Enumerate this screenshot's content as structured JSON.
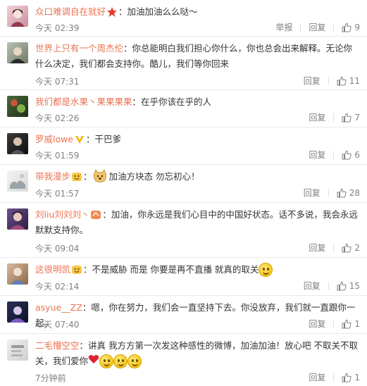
{
  "comments": [
    {
      "username": "众口难调自在就好",
      "badge": "star-badge-icon",
      "text": "：加油加油么么哒～",
      "time": "今天 02:39",
      "report_label": "举报",
      "reply_label": "回复",
      "likes": "9"
    },
    {
      "username": "世界上只有一个周杰伦",
      "text": "：你总能明白我们担心你什么，你也总会出来解释。无论你什么决定，我们都会支持你。酷儿，我们等你回来",
      "time": "今天 07:31",
      "reply_label": "回复",
      "likes": "11"
    },
    {
      "username": "我们都是水果丶果果果果",
      "text": "：在乎你该在乎的人",
      "time": "今天 02:26",
      "reply_label": "回复",
      "likes": "7"
    },
    {
      "username": "罗威lowe",
      "badge": "vip-v-badge-icon",
      "text": "：干巴爹",
      "time": "今天 01:59",
      "reply_label": "回复",
      "likes": "6"
    },
    {
      "username": "带我漫步",
      "badge": "fan-badge-icon",
      "text_prefix": "：",
      "text": "加油方块态 勿忘初心！",
      "time": "今天 01:57",
      "reply_label": "回复",
      "likes": "28"
    },
    {
      "username": "刘liu刘刘刘丶",
      "badge": "fan-badge-icon",
      "text": "：加油，你永远是我们心目中的中国好状态。话不多说，我会永远默默支持你。",
      "time": "今天 09:04",
      "reply_label": "回复",
      "likes": "2"
    },
    {
      "username": "这很明凯",
      "badge": "fan-badge-icon",
      "text": "：不是威胁 而是 你要是再不直播 就真的取关",
      "time": "今天 02:14",
      "reply_label": "回复",
      "likes": "15"
    },
    {
      "username": "asyue__ZZ",
      "text": "：嗯，你在努力，我们会一直坚持下去。你没放弃，我们就一直跟你一起。",
      "time": "今天 07:40",
      "reply_label": "回复",
      "likes": "1"
    },
    {
      "username": "二毛懵空空",
      "text": "：讲真 我方方第一次发这种感性的微博，加油加油！放心吧 不取关不取关，我们爱你",
      "time": "7分钟前",
      "reply_label": "回复",
      "likes": "1"
    }
  ],
  "colors": {
    "username": "#eb7350",
    "meta": "#808080",
    "text": "#333333",
    "divider": "#eaeaea"
  }
}
